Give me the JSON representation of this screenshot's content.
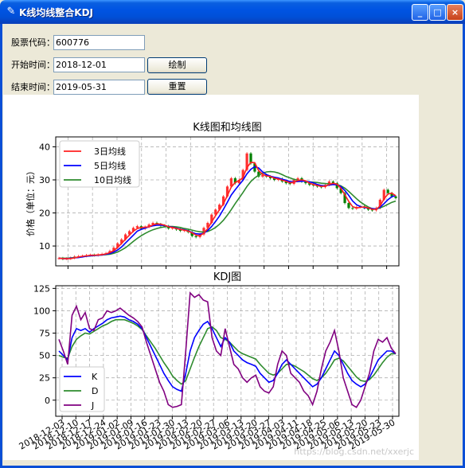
{
  "window": {
    "title": "K线均线整合KDJ",
    "min_label": "_",
    "max_label": "□",
    "close_label": "×"
  },
  "form": {
    "code_label": "股票代码：",
    "code_value": "600776",
    "start_label": "开始时间：",
    "start_value": "2018-12-01",
    "end_label": "结束时间：",
    "end_value": "2019-05-31",
    "draw_button": "绘制",
    "reset_button": "重置"
  },
  "chart_data": [
    {
      "type": "candlestick+line",
      "title": "K线图和均线图",
      "ylabel": "价格（单位：元）",
      "ylim": [
        4,
        43
      ],
      "yticks": [
        10,
        20,
        30,
        40
      ],
      "legend": {
        "placement": "top-left",
        "entries": [
          "3日均线",
          "5日均线",
          "10日均线"
        ]
      },
      "colors": {
        "ma3": "#ff2020",
        "ma5": "#0000ff",
        "ma10": "#2e8b2e",
        "up": "#ff3030",
        "down": "#008000"
      },
      "close": [
        6.3,
        6.1,
        6.2,
        6.4,
        6.8,
        6.9,
        7.0,
        7.2,
        7.3,
        7.2,
        7.4,
        7.6,
        7.8,
        8.5,
        9.5,
        10.8,
        12.0,
        13.5,
        14.5,
        15.5,
        16.0,
        15.2,
        15.8,
        16.5,
        17.0,
        16.6,
        16.2,
        16.0,
        15.3,
        15.5,
        15.0,
        14.6,
        14.8,
        14.2,
        13.0,
        12.7,
        13.5,
        15.5,
        17.0,
        19.5,
        21.0,
        22.5,
        25.0,
        28.0,
        30.5,
        29.0,
        30.0,
        33.0,
        38.0,
        35.0,
        32.5,
        31.0,
        31.5,
        31.0,
        30.5,
        30.0,
        30.3,
        29.5,
        29.0,
        28.8,
        30.0,
        30.5,
        29.5,
        29.0,
        28.5,
        28.3,
        28.0,
        27.8,
        28.5,
        29.5,
        29.0,
        27.5,
        26.0,
        23.0,
        21.5,
        21.3,
        21.8,
        22.0,
        21.5,
        21.0,
        20.8,
        21.5,
        24.0,
        27.0,
        26.0,
        25.0,
        24.5
      ],
      "ma3": [
        6.3,
        6.2,
        6.2,
        6.2,
        6.4,
        6.7,
        6.9,
        7.0,
        7.2,
        7.2,
        7.3,
        7.4,
        7.6,
        8.0,
        8.6,
        9.6,
        10.8,
        12.1,
        13.3,
        14.5,
        15.3,
        15.6,
        15.7,
        15.8,
        16.4,
        16.7,
        16.6,
        16.3,
        15.8,
        15.6,
        15.3,
        15.0,
        14.8,
        14.5,
        14.0,
        13.3,
        13.1,
        13.9,
        15.3,
        17.3,
        19.2,
        21.0,
        22.8,
        25.2,
        27.8,
        29.2,
        29.8,
        30.7,
        33.7,
        35.3,
        35.2,
        32.8,
        31.7,
        31.2,
        31.0,
        30.5,
        30.3,
        29.9,
        29.6,
        29.1,
        29.3,
        29.8,
        30.0,
        29.7,
        29.0,
        28.6,
        28.3,
        28.0,
        28.1,
        28.6,
        29.0,
        28.7,
        27.5,
        25.5,
        23.5,
        21.9,
        21.5,
        21.7,
        21.8,
        21.5,
        21.1,
        21.1,
        22.1,
        24.2,
        25.7,
        26.0,
        25.2
      ],
      "ma5": [
        6.3,
        6.2,
        6.2,
        6.3,
        6.4,
        6.5,
        6.7,
        6.9,
        7.0,
        7.1,
        7.2,
        7.3,
        7.5,
        7.7,
        8.2,
        8.8,
        9.7,
        10.9,
        12.1,
        13.3,
        14.5,
        15.0,
        15.4,
        15.8,
        16.1,
        16.3,
        16.3,
        16.2,
        15.9,
        15.7,
        15.4,
        15.1,
        14.9,
        14.6,
        14.1,
        13.7,
        13.6,
        13.9,
        14.7,
        15.9,
        17.4,
        19.1,
        21.1,
        23.2,
        25.4,
        27.0,
        28.5,
        29.9,
        31.8,
        33.2,
        34.0,
        33.6,
        32.4,
        31.6,
        31.1,
        30.8,
        30.6,
        30.2,
        29.9,
        29.5,
        29.4,
        29.5,
        29.6,
        29.6,
        29.4,
        29.1,
        28.6,
        28.3,
        28.2,
        28.4,
        28.6,
        28.5,
        28.0,
        26.8,
        25.3,
        23.6,
        22.5,
        21.9,
        21.6,
        21.5,
        21.3,
        21.2,
        21.7,
        22.8,
        24.0,
        24.9,
        25.3
      ],
      "ma10": [
        6.3,
        6.3,
        6.3,
        6.4,
        6.5,
        6.6,
        6.8,
        6.9,
        7.0,
        7.1,
        7.2,
        7.3,
        7.4,
        7.5,
        7.8,
        8.2,
        8.8,
        9.5,
        10.4,
        11.4,
        12.3,
        13.1,
        13.8,
        14.4,
        14.9,
        15.3,
        15.6,
        15.8,
        15.9,
        15.9,
        15.8,
        15.6,
        15.3,
        15.1,
        14.8,
        14.5,
        14.3,
        14.2,
        14.4,
        14.9,
        15.6,
        16.6,
        17.8,
        19.3,
        21.0,
        22.8,
        24.5,
        26.2,
        28.0,
        29.5,
        30.6,
        31.4,
        32.0,
        32.4,
        32.5,
        32.4,
        32.1,
        31.6,
        31.0,
        30.6,
        30.2,
        29.9,
        29.7,
        29.5,
        29.4,
        29.3,
        29.2,
        29.0,
        28.9,
        28.8,
        28.8,
        28.6,
        28.2,
        27.5,
        26.5,
        25.4,
        24.3,
        23.3,
        22.5,
        21.8,
        21.3,
        21.2,
        21.5,
        22.0,
        22.6,
        23.2,
        23.6
      ]
    },
    {
      "type": "line",
      "title": "KDJ图",
      "ylim": [
        -18,
        128
      ],
      "yticks": [
        0,
        25,
        50,
        75,
        100,
        125
      ],
      "legend": {
        "placement": "bottom-left",
        "entries": [
          "K",
          "D",
          "J"
        ]
      },
      "colors": {
        "K": "#0000ff",
        "D": "#2e8b2e",
        "J": "#800080"
      },
      "x_tick_labels": [
        "2018-12-03",
        "2018-12-10",
        "2018-12-17",
        "2018-12-24",
        "2019-01-02",
        "2019-01-09",
        "2019-01-16",
        "2019-01-23",
        "2019-01-30",
        "2019-02-13",
        "2019-02-20",
        "2019-02-27",
        "2019-03-06",
        "2019-03-13",
        "2019-03-20",
        "2019-03-27",
        "2019-04-03",
        "2019-04-11",
        "2019-04-18",
        "2019-04-25",
        "2019-05-06",
        "2019-05-13",
        "2019-05-20",
        "2019-05-23",
        "2019-05-30"
      ],
      "K": [
        55,
        50,
        45,
        70,
        80,
        78,
        80,
        76,
        80,
        83,
        86,
        90,
        92,
        93,
        94,
        93,
        90,
        88,
        85,
        80,
        70,
        60,
        50,
        40,
        30,
        22,
        15,
        12,
        10,
        30,
        55,
        70,
        78,
        85,
        88,
        80,
        70,
        60,
        70,
        65,
        55,
        50,
        45,
        42,
        40,
        38,
        30,
        25,
        20,
        22,
        30,
        40,
        45,
        40,
        35,
        30,
        25,
        20,
        15,
        18,
        25,
        35,
        45,
        55,
        50,
        40,
        30,
        22,
        18,
        15,
        18,
        25,
        35,
        45,
        50,
        55,
        55,
        52
      ],
      "D": [
        50,
        48,
        47,
        60,
        68,
        72,
        75,
        74,
        77,
        80,
        83,
        85,
        88,
        90,
        90,
        90,
        88,
        86,
        83,
        79,
        72,
        65,
        58,
        50,
        42,
        35,
        27,
        22,
        18,
        22,
        35,
        48,
        60,
        70,
        80,
        82,
        78,
        70,
        68,
        65,
        60,
        55,
        52,
        50,
        48,
        46,
        40,
        35,
        30,
        28,
        30,
        35,
        40,
        40,
        38,
        35,
        32,
        28,
        24,
        22,
        25,
        30,
        37,
        45,
        47,
        44,
        38,
        32,
        26,
        22,
        21,
        23,
        28,
        35,
        42,
        48,
        52,
        52
      ],
      "J": [
        68,
        55,
        40,
        95,
        105,
        90,
        98,
        80,
        78,
        90,
        92,
        100,
        98,
        100,
        103,
        99,
        95,
        92,
        88,
        82,
        65,
        50,
        35,
        20,
        10,
        -5,
        -8,
        -7,
        -5,
        55,
        120,
        115,
        118,
        112,
        110,
        70,
        55,
        50,
        80,
        60,
        40,
        35,
        25,
        20,
        25,
        28,
        15,
        10,
        8,
        15,
        40,
        55,
        50,
        30,
        25,
        20,
        10,
        5,
        -5,
        10,
        35,
        55,
        65,
        78,
        55,
        25,
        10,
        -5,
        -8,
        0,
        15,
        30,
        55,
        68,
        65,
        70,
        58,
        52
      ]
    }
  ],
  "watermark": "https://blog.csdn.net/xxerjc"
}
